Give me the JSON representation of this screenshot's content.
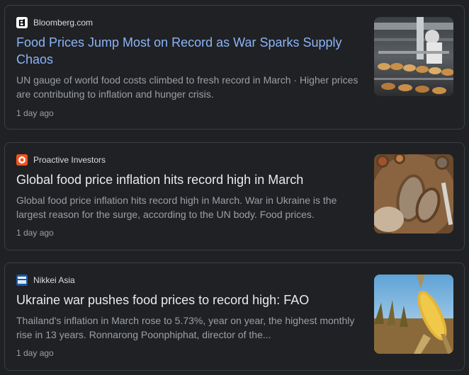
{
  "articles": [
    {
      "source": "Bloomberg.com",
      "source_icon": "bloomberg-logo-icon",
      "title": "Food Prices Jump Most on Record as War Sparks Supply Chaos",
      "snippet": "UN gauge of world food costs climbed to fresh record in March · Higher prices are contributing to inflation and hunger crisis.",
      "time": "1 day ago",
      "thumbnail": "bakery-bread-production-image"
    },
    {
      "source": "Proactive Investors",
      "source_icon": "proactive-investors-logo-icon",
      "title": "Global food price inflation hits record high in March",
      "snippet": "Global food price inflation hits record high in March. War in Ukraine is the largest reason for the surge, according to the UN body. Food prices.",
      "time": "1 day ago",
      "thumbnail": "sliced-bread-loaf-image"
    },
    {
      "source": "Nikkei Asia",
      "source_icon": "nikkei-asia-logo-icon",
      "title": "Ukraine war pushes food prices to record high: FAO",
      "snippet": "Thailand's inflation in March rose to 5.73%, year on year, the highest monthly rise in 13 years. Ronnarong Poonphiphat, director of the...",
      "time": "1 day ago",
      "thumbnail": "corn-cob-field-image"
    }
  ],
  "colors": {
    "background": "#202124",
    "border": "#3c4043",
    "link_title": "#8ab4f8",
    "title": "#e8eaed",
    "snippet": "#9aa0a6",
    "source": "#dadce0"
  }
}
